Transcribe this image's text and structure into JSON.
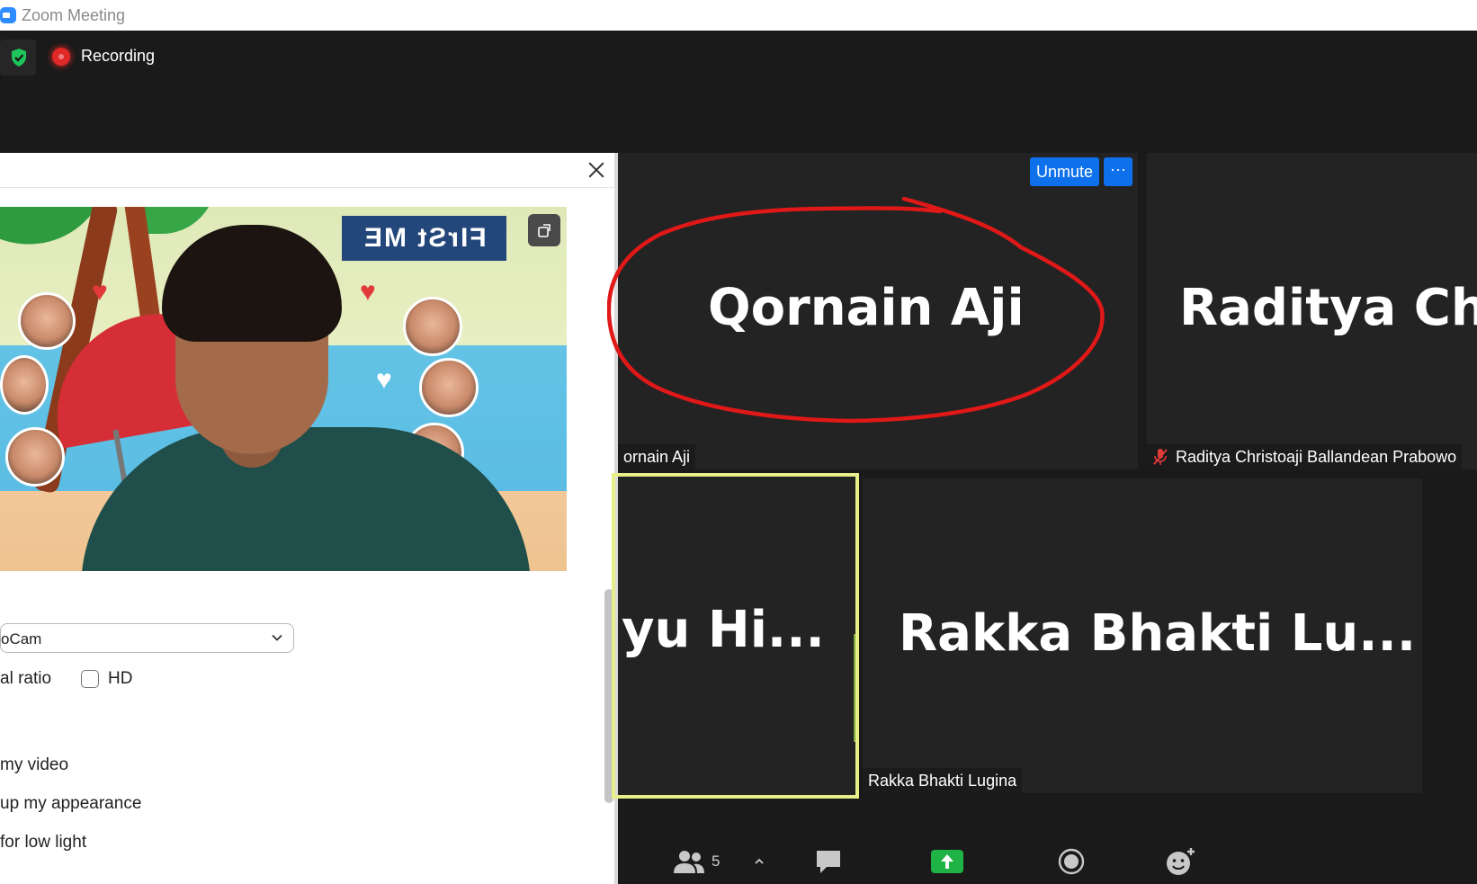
{
  "window": {
    "title": "Zoom Meeting"
  },
  "topbar": {
    "recording_label": "Recording"
  },
  "settings_panel": {
    "preview_sign_text": "FIrSt ME",
    "camera_select_value": "oCam",
    "ratio_label": "al ratio",
    "hd_label": "HD",
    "options": [
      "my video",
      "up my appearance",
      "for low light"
    ]
  },
  "tiles": [
    {
      "display_name": "Qornain Aji",
      "label": "ornain Aji",
      "unmute_label": "Unmute",
      "more_label": "···"
    },
    {
      "display_name": "Raditya  Ch",
      "label": "Raditya Christoaji Ballandean Prabowo",
      "muted": true
    },
    {
      "display_name": "yu  Hi...",
      "active_speaker": true
    },
    {
      "display_name": "Rakka  Bhakti  Lu...",
      "label": "Rakka Bhakti Lugina"
    }
  ],
  "toolbar": {
    "participants_count": "5"
  },
  "colors": {
    "accent": "#0e71eb",
    "annotation": "#e01818",
    "active_speaker": "#e8ef8a",
    "share": "#1fb244"
  }
}
